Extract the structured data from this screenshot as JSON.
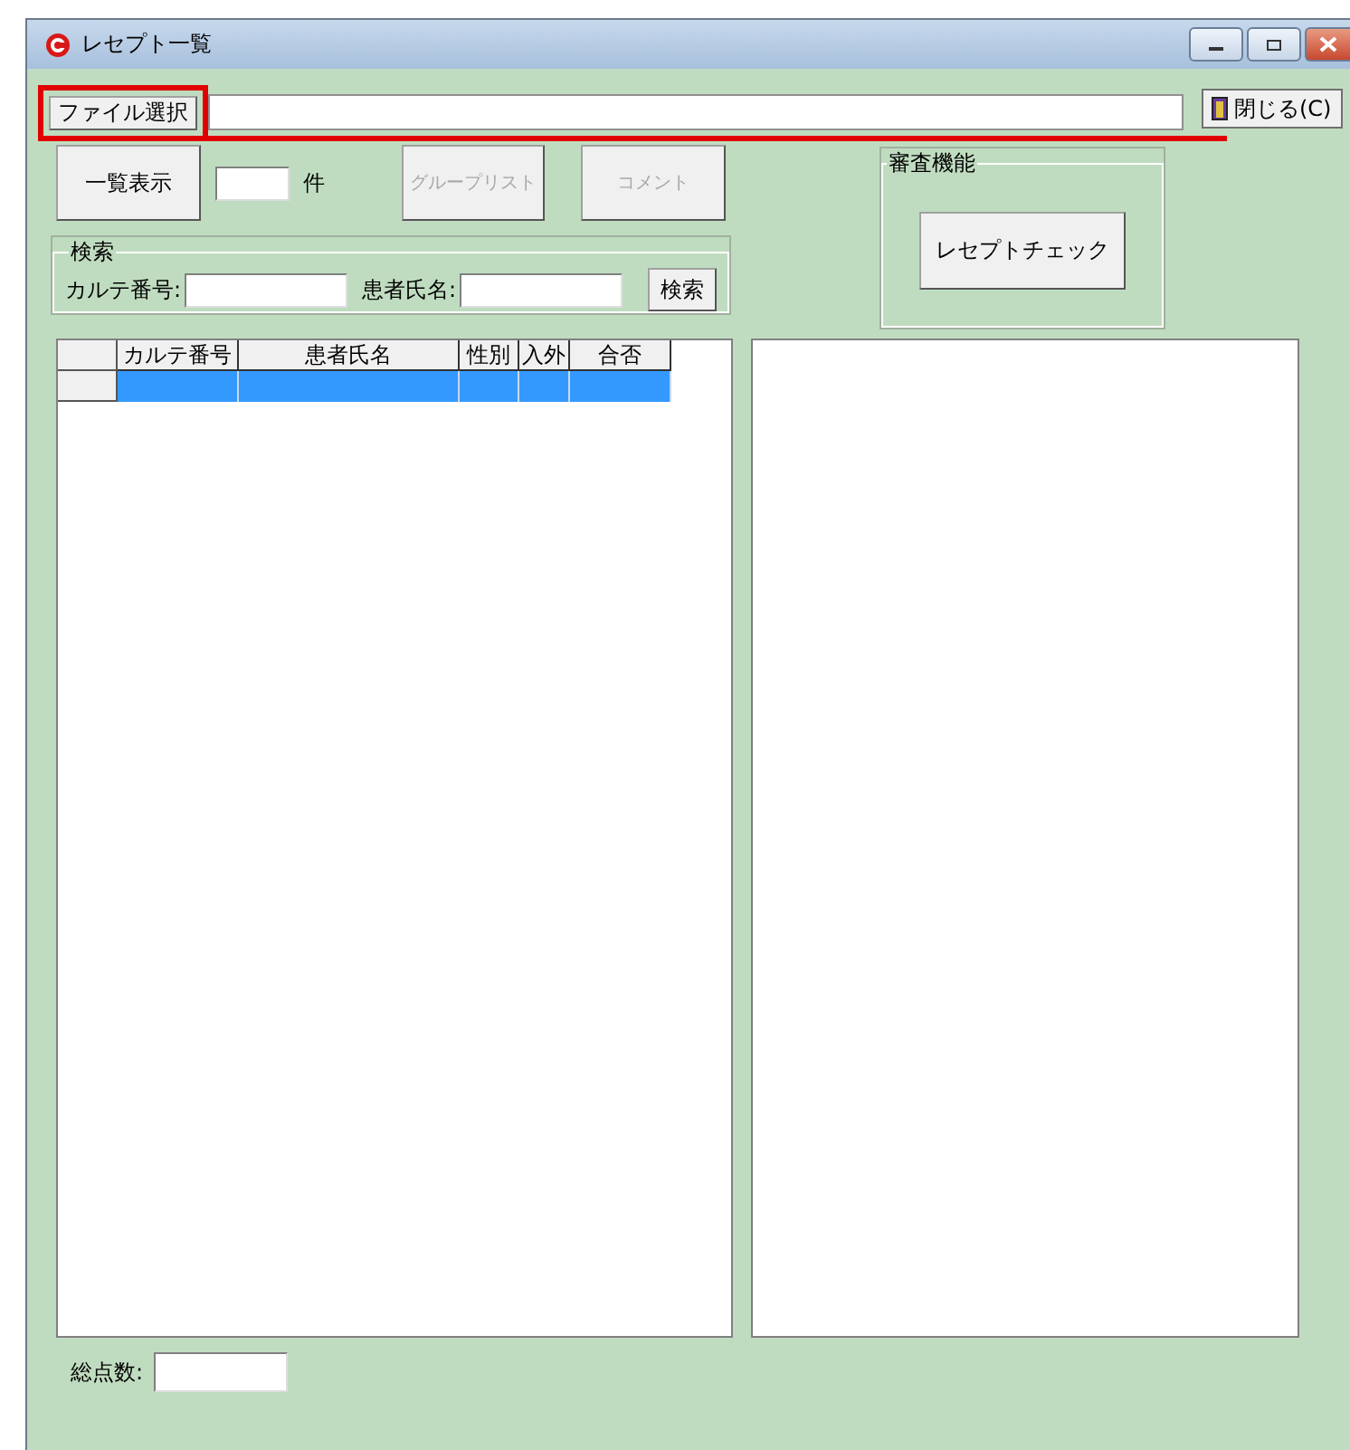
{
  "window": {
    "title": "レセプト一覧"
  },
  "file_bar": {
    "button": "ファイル選択",
    "close_button": "閉じる(C)"
  },
  "toolbar": {
    "list_button": "一覧表示",
    "count_unit": "件",
    "buttons": [
      {
        "label": "グループリスト",
        "disabled": true
      },
      {
        "label": "コメント",
        "disabled": true
      }
    ]
  },
  "search": {
    "title": "検索",
    "fields": [
      {
        "label": "カルテ番号:"
      },
      {
        "label": "患者氏名:"
      }
    ],
    "button": "検索"
  },
  "review": {
    "title": "審査機能",
    "button": "レセプトチェック"
  },
  "table": {
    "columns": [
      "カルテ番号",
      "患者氏名",
      "性別",
      "入外",
      "合否"
    ],
    "rows": [
      {
        "selected": true
      }
    ]
  },
  "footer": {
    "label": "総点数:"
  }
}
